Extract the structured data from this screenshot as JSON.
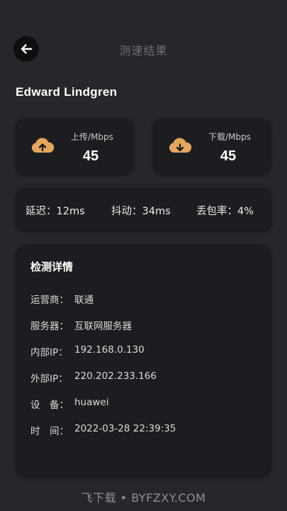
{
  "header": {
    "title": "测速结果",
    "back_icon": "arrow-left-icon"
  },
  "user": {
    "name": "Edward Lindgren"
  },
  "speed": {
    "upload": {
      "label": "上传/Mbps",
      "value": "45",
      "icon": "cloud-upload-icon"
    },
    "download": {
      "label": "下载/Mbps",
      "value": "45",
      "icon": "cloud-download-icon"
    },
    "accent_color": "#e4a65b"
  },
  "metrics": {
    "latency": "延迟：12ms",
    "jitter": "抖动：34ms",
    "packet_loss": "丢包率：4%"
  },
  "details": {
    "title": "检测详情",
    "rows": [
      {
        "label": "运营商：",
        "value": "联通"
      },
      {
        "label": "服务器：",
        "value": "互联网服务器"
      },
      {
        "label": "内部IP：",
        "value": "192.168.0.130"
      },
      {
        "label": "外部IP：",
        "value": "220.202.233.166"
      },
      {
        "label": "设　备：",
        "value": "huawei"
      },
      {
        "label": "时　间：",
        "value": "2022-03-28  22:39:35"
      }
    ]
  },
  "watermark": "飞下载 • BYFZXY.COM"
}
